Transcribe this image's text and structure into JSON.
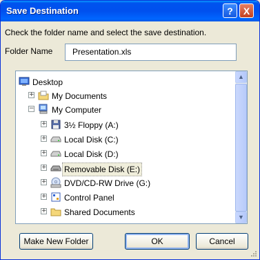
{
  "window": {
    "title": "Save Destination"
  },
  "title_buttons": {
    "help": "?",
    "close": "X"
  },
  "instruction": "Check the folder name and select the save destination.",
  "folder": {
    "label": "Folder Name",
    "value": "Presentation.xls"
  },
  "tree": {
    "items": [
      {
        "label": "Desktop",
        "icon": "desktop-icon",
        "expander": ""
      },
      {
        "label": "My Documents",
        "icon": "folder-icon",
        "expander": "+"
      },
      {
        "label": "My Computer",
        "icon": "computer-icon",
        "expander": "−"
      },
      {
        "label": "3½ Floppy (A:)",
        "icon": "floppy-icon",
        "expander": "+"
      },
      {
        "label": "Local Disk (C:)",
        "icon": "hard-disk-icon",
        "expander": "+"
      },
      {
        "label": "Local Disk (D:)",
        "icon": "hard-disk-icon",
        "expander": "+"
      },
      {
        "label": "Removable Disk (E:)",
        "icon": "removable-disk-icon",
        "expander": "+",
        "selected": true
      },
      {
        "label": "DVD/CD-RW Drive (G:)",
        "icon": "dvd-drive-icon",
        "expander": "+"
      },
      {
        "label": "Control Panel",
        "icon": "control-panel-icon",
        "expander": "+"
      },
      {
        "label": "Shared Documents",
        "icon": "folder-icon",
        "expander": "+"
      }
    ]
  },
  "scrollbar": {
    "up": "▲",
    "down": "▼"
  },
  "buttons": {
    "make_new_folder": "Make New Folder",
    "ok": "OK",
    "cancel": "Cancel"
  },
  "colors": {
    "title_bar": "#0054e3",
    "close_button": "#d2502d",
    "selection": "#f0eedb",
    "dialog_bg": "#ece9d8"
  }
}
